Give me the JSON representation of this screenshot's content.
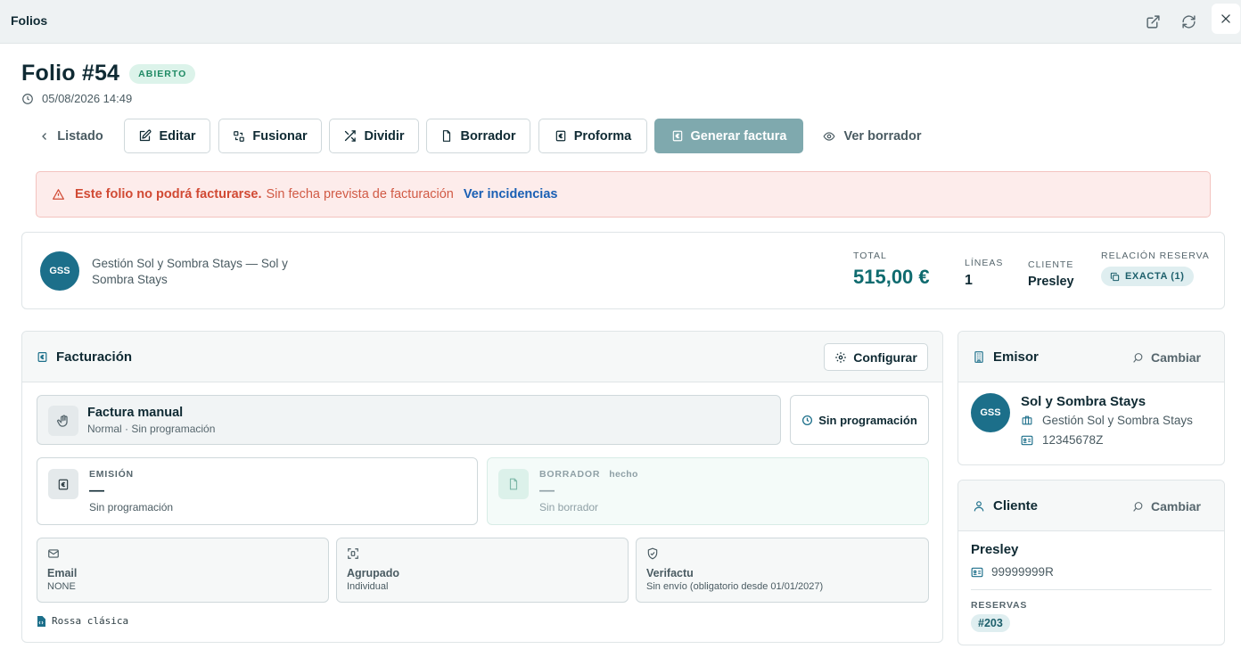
{
  "window": {
    "title": "Folios"
  },
  "folio": {
    "title": "Folio #54",
    "status": "ABIERTO",
    "datetime": "05/08/2026 14:49"
  },
  "actions": {
    "back": "Listado",
    "edit": "Editar",
    "merge": "Fusionar",
    "split": "Dividir",
    "draft": "Borrador",
    "proforma": "Proforma",
    "generate_invoice": "Generar factura",
    "view_draft": "Ver borrador"
  },
  "alert": {
    "strong": "Este folio no podrá facturarse.",
    "text": "Sin fecha prevista de facturación",
    "link": "Ver incidencias"
  },
  "summary": {
    "avatar": "GSS",
    "company": "Gestión Sol y Sombra Stays — Sol y Sombra Stays",
    "total_label": "TOTAL",
    "total": "515,00 €",
    "lines_label": "LÍNEAS",
    "lines": "1",
    "client_label": "CLIENTE",
    "client": "Presley",
    "relation_label": "RELACIÓN RESERVA",
    "relation": "EXACTA (1)"
  },
  "billing": {
    "title": "Facturación",
    "configure": "Configurar",
    "mode_title": "Factura manual",
    "mode_sub": "Normal · Sin programación",
    "schedule": "Sin programación",
    "emission_label": "EMISIÓN",
    "emission_value": "—",
    "emission_sub": "Sin programación",
    "draft_label": "BORRADOR",
    "draft_state": "hecho",
    "draft_value": "—",
    "draft_sub": "Sin borrador",
    "email_title": "Email",
    "email_value": "NONE",
    "grouping_title": "Agrupado",
    "grouping_value": "Individual",
    "verifactu_title": "Verifactu",
    "verifactu_value": "Sin envío (obligatorio desde 01/01/2027)",
    "theme": "Rossa clásica"
  },
  "issuer": {
    "title": "Emisor",
    "change": "Cambiar",
    "avatar": "GSS",
    "name": "Sol y Sombra Stays",
    "legal_name": "Gestión Sol y Sombra Stays",
    "tax_id": "12345678Z"
  },
  "client": {
    "title": "Cliente",
    "change": "Cambiar",
    "name": "Presley",
    "tax_id": "99999999R",
    "bookings_label": "RESERVAS",
    "booking": "#203"
  },
  "colors": {
    "accent": "#1c6f8a",
    "primary_button": "#7fa9ae",
    "status_open_bg": "#dcf3ea",
    "alert_bg": "#fdeceb",
    "alert_text": "#d14a34",
    "total": "#0f6b6f"
  }
}
